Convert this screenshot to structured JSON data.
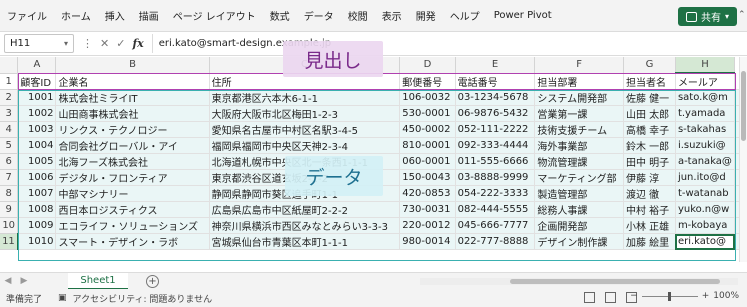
{
  "ribbon": {
    "tabs": [
      "ファイル",
      "ホーム",
      "挿入",
      "描画",
      "ページ レイアウト",
      "数式",
      "データ",
      "校閲",
      "表示",
      "開発",
      "ヘルプ",
      "Power Pivot"
    ],
    "share_label": "共有",
    "share_icon": "share-icon",
    "accent": "#1e7145"
  },
  "formula_bar": {
    "name_box": "H11",
    "formula": "eri.kato@smart-design.example.jp"
  },
  "columns": [
    "A",
    "B",
    "C",
    "D",
    "E",
    "F",
    "G",
    "H"
  ],
  "rows": [
    {
      "n": "1",
      "cells": [
        "顧客ID",
        "企業名",
        "住所",
        "郵便番号",
        "電話番号",
        "担当部署",
        "担当者名",
        "メールア"
      ]
    },
    {
      "n": "2",
      "cells": [
        "1001",
        "株式会社ミライIT",
        "東京都港区六本木6-1-1",
        "106-0032",
        "03-1234-5678",
        "システム開発部",
        "佐藤 健一",
        "sato.k@m"
      ]
    },
    {
      "n": "3",
      "cells": [
        "1002",
        "山田商事株式会社",
        "大阪府大阪市北区梅田1-2-3",
        "530-0001",
        "06-9876-5432",
        "営業第一課",
        "山田 太郎",
        "t.yamada"
      ]
    },
    {
      "n": "4",
      "cells": [
        "1003",
        "リンクス・テクノロジー",
        "愛知県名古屋市中村区名駅3-4-5",
        "450-0002",
        "052-111-2222",
        "技術支援チーム",
        "高橋 幸子",
        "s-takahas"
      ]
    },
    {
      "n": "5",
      "cells": [
        "1004",
        "合同会社グローバル・アイ",
        "福岡県福岡市中央区天神2-3-4",
        "810-0001",
        "092-333-4444",
        "海外事業部",
        "鈴木 一郎",
        "i.suzuki@"
      ]
    },
    {
      "n": "6",
      "cells": [
        "1005",
        "北海フーズ株式会社",
        "北海道札幌市中央区北一条西1-1-1",
        "060-0001",
        "011-555-6666",
        "物流管理課",
        "田中 明子",
        "a-tanaka@"
      ]
    },
    {
      "n": "7",
      "cells": [
        "1006",
        "デジタル・フロンティア",
        "東京都渋谷区道玄坂2-2-2",
        "150-0043",
        "03-8888-9999",
        "マーケティング部",
        "伊藤 淳",
        "jun.ito@d"
      ]
    },
    {
      "n": "8",
      "cells": [
        "1007",
        "中部マシナリー",
        "静岡県静岡市葵区追手町1-1",
        "420-0853",
        "054-222-3333",
        "製造管理部",
        "渡辺 徹",
        "t-watanab"
      ]
    },
    {
      "n": "9",
      "cells": [
        "1008",
        "西日本ロジスティクス",
        "広島県広島市中区紙屋町2-2-2",
        "730-0031",
        "082-444-5555",
        "総務人事課",
        "中村 裕子",
        "yuko.n@w"
      ]
    },
    {
      "n": "10",
      "cells": [
        "1009",
        "エコライフ・ソリューションズ",
        "神奈川県横浜市西区みなとみらい3-3-3",
        "220-0012",
        "045-666-7777",
        "企画開発部",
        "小林 正雄",
        "m-kobaya"
      ]
    },
    {
      "n": "11",
      "cells": [
        "1010",
        "スマート・デザイン・ラボ",
        "宮城県仙台市青葉区本町1-1-1",
        "980-0014",
        "022-777-8888",
        "デザイン制作課",
        "加藤 絵里",
        "eri.kato@"
      ]
    }
  ],
  "overlays": {
    "header_label": "見出し",
    "data_label": "データ"
  },
  "sheet": {
    "tab_label": "Sheet1"
  },
  "status": {
    "ready": "準備完了",
    "accessibility": "アクセシビリティ: 問題ありません",
    "zoom": "100%"
  }
}
